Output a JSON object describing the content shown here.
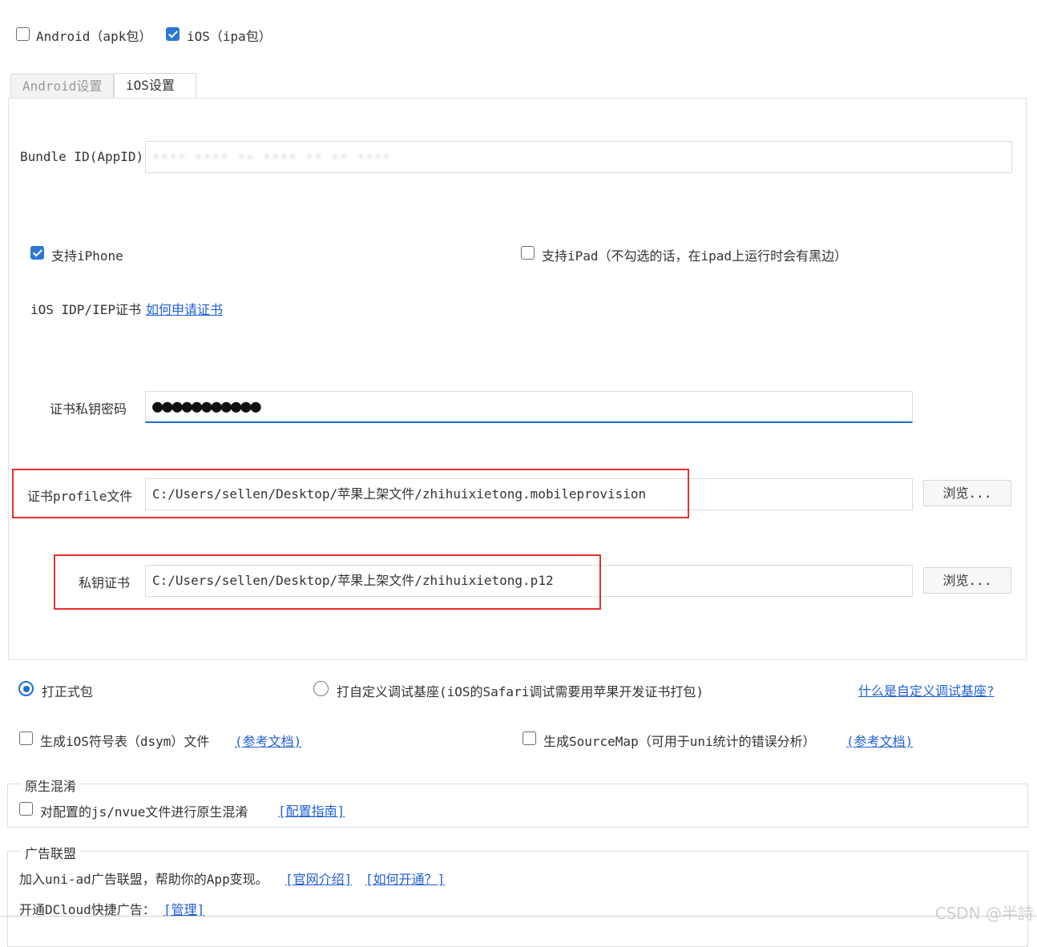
{
  "platforms": {
    "android": {
      "label": "Android（apk包）",
      "checked": false
    },
    "ios": {
      "label": "iOS（ipa包）",
      "checked": true
    }
  },
  "tabs": [
    {
      "label": "Android设置",
      "active": false
    },
    {
      "label": "iOS设置",
      "active": true
    }
  ],
  "ios_settings": {
    "bundle_id": {
      "label": "Bundle ID(AppID)",
      "value": "···· ···· ·- ···· ·· ·· ····"
    },
    "support_iphone": {
      "label": "支持iPhone",
      "checked": true
    },
    "support_ipad": {
      "label": "支持iPad（不勾选的话，在ipad上运行时会有黑边）",
      "checked": false
    },
    "certificate": {
      "label": "iOS IDP/IEP证书",
      "help_link": "如何申请证书"
    },
    "private_key_password": {
      "label": "证书私钥密码",
      "value": "●●●●●●●●●●●"
    },
    "profile_file": {
      "label": "证书profile文件",
      "value": "C:/Users/sellen/Desktop/苹果上架文件/zhihuixietong.mobileprovision",
      "browse_label": "浏览..."
    },
    "private_key_cert": {
      "label": "私钥证书",
      "value": "C:/Users/sellen/Desktop/苹果上架文件/zhihuixietong.p12",
      "browse_label": "浏览..."
    }
  },
  "build_type": {
    "formal": {
      "label": "打正式包",
      "selected": true
    },
    "custom_base": {
      "label": "打自定义调试基座(iOS的Safari调试需要用苹果开发证书打包)",
      "selected": false
    },
    "help_link": "什么是自定义调试基座?"
  },
  "options": {
    "dsym": {
      "label": "生成iOS符号表（dsym）文件",
      "link": "(参考文档)",
      "checked": false
    },
    "sourcemap": {
      "label": "生成SourceMap（可用于uni统计的错误分析）",
      "link": "(参考文档)",
      "checked": false
    }
  },
  "obfuscation": {
    "title": "原生混淆",
    "option_label": "对配置的js/nvue文件进行原生混淆",
    "link": "[配置指南]",
    "checked": false
  },
  "ad_alliance": {
    "title": "广告联盟",
    "join_text": "加入uni-ad广告联盟，帮助你的App变现。",
    "intro_link": "[官网介绍]",
    "how_link": "[如何开通？]",
    "quick_ad_label": "开通DCloud快捷广告：",
    "manage_link": "[管理]"
  },
  "watermark": "CSDN @半詩",
  "colors": {
    "accent": "#2d77d4",
    "link": "#1f5fd8",
    "highlight": "#e8302b"
  }
}
